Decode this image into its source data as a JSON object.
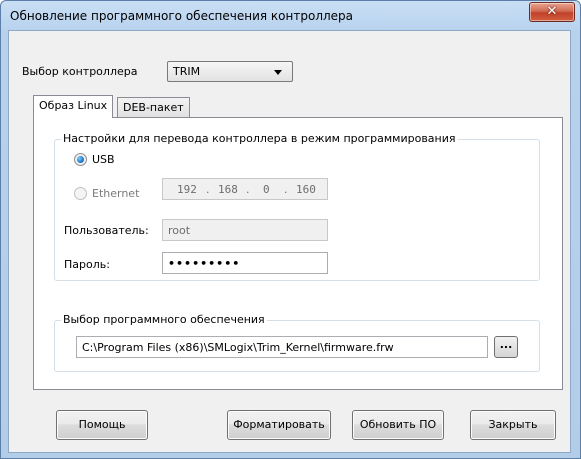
{
  "window": {
    "title": "Обновление программного обеспечения контроллера",
    "close_glyph": "✕"
  },
  "controller": {
    "label": "Выбор контроллера",
    "selected": "TRIM"
  },
  "tabs": [
    {
      "label": "Образ Linux",
      "active": true
    },
    {
      "label": "DEB-пакет",
      "active": false
    }
  ],
  "settings": {
    "group_title": "Настройки для перевода контроллера в режим программирования",
    "usb_label": "USB",
    "usb_checked": true,
    "ethernet_label": "Ethernet",
    "ethernet_checked": false,
    "ip": [
      "192",
      "168",
      "0",
      "160"
    ],
    "user_label": "Пользователь:",
    "user_value": "root",
    "password_label": "Пароль:",
    "password_value": "•••••••••"
  },
  "software": {
    "group_title": "Выбор программного обеспечения",
    "path": "C:\\Program Files (x86)\\SMLogix\\Trim_Kernel\\firmware.frw",
    "browse_label": "..."
  },
  "buttons": {
    "help": "Помощь",
    "format": "Форматировать",
    "update": "Обновить ПО",
    "close": "Закрыть"
  },
  "colors": {
    "titlebar": "#b8d2ee",
    "close": "#c0412a",
    "radio_selected": "#1d77c7"
  }
}
